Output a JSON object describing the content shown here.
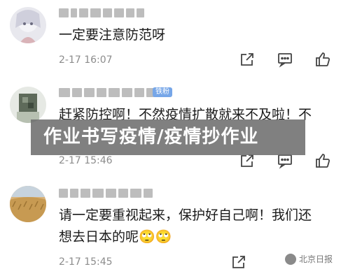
{
  "comments": [
    {
      "text": "一定要注意防范呀",
      "time": "2-17 16:07"
    },
    {
      "badge": "铁粉",
      "text": "赶紧防控啊！不然疫情扩散就来不及啦！不",
      "time": "2-17 15:46"
    },
    {
      "text_line1": "请一定要重视起来，保护好自己啊！我们还",
      "text_line2": "想去日本的呢🙄🙄",
      "time": "2-17 15:45"
    }
  ],
  "banner_title": "作业书写疫情/疫情抄作业",
  "watermark": "北京日报",
  "colors": {
    "badge": "#76a6e8",
    "time": "#8c8c8c",
    "banner": "#6e6e6e"
  },
  "icons": [
    "share-icon",
    "comment-icon",
    "like-icon"
  ]
}
